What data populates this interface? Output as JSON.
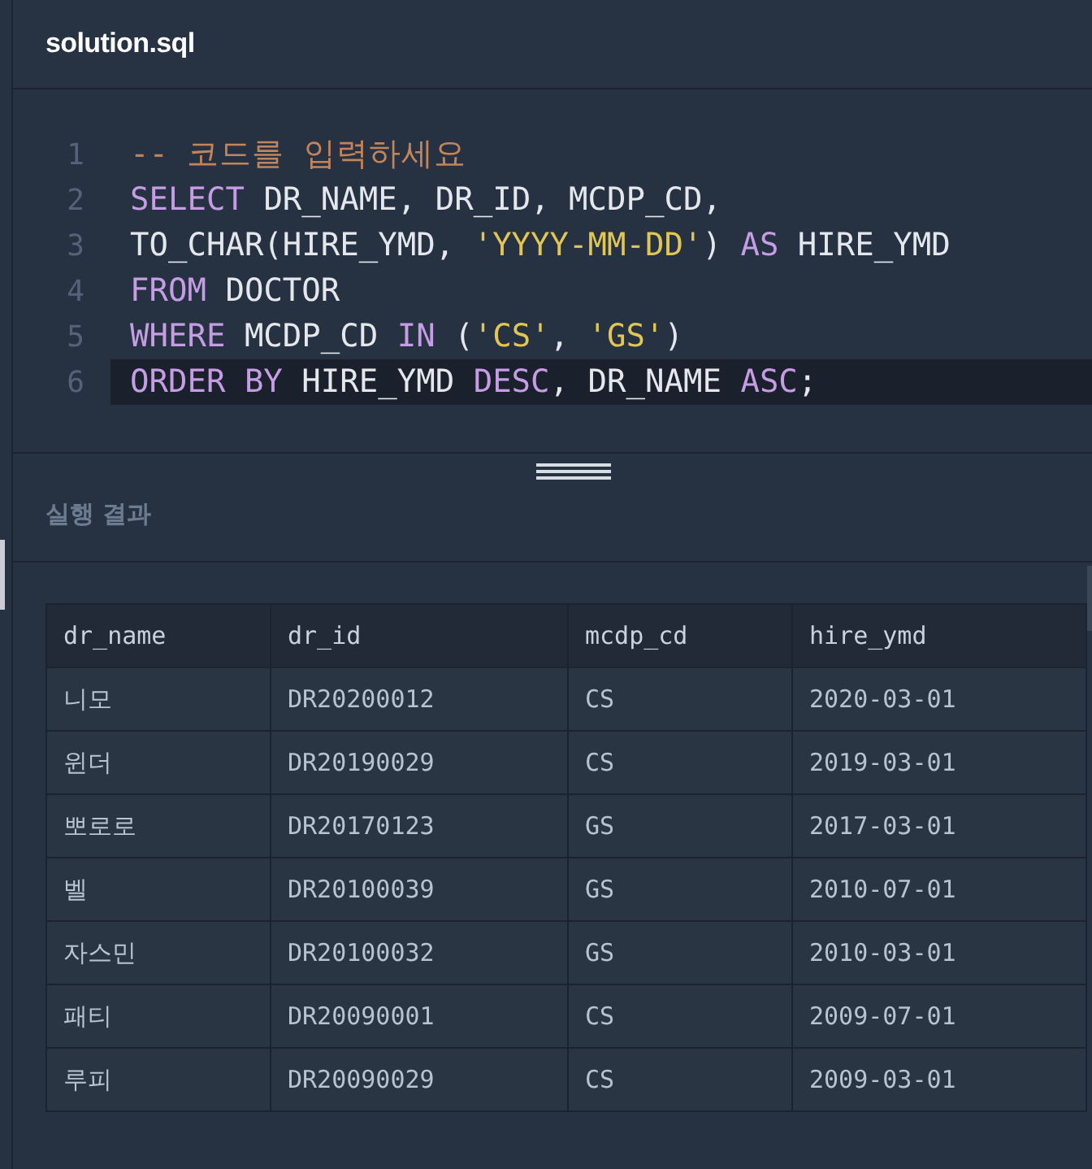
{
  "file_tab": {
    "title": "solution.sql"
  },
  "editor": {
    "lines": [
      {
        "number": "1",
        "active": false,
        "tokens": [
          {
            "kind": "comment",
            "text": "-- 코드를 입력하세요"
          }
        ]
      },
      {
        "number": "2",
        "active": false,
        "tokens": [
          {
            "kind": "keyword",
            "text": "SELECT"
          },
          {
            "kind": "plain",
            "text": " DR_NAME, DR_ID, MCDP_CD,"
          }
        ]
      },
      {
        "number": "3",
        "active": false,
        "tokens": [
          {
            "kind": "plain",
            "text": "TO_CHAR(HIRE_YMD, "
          },
          {
            "kind": "string",
            "text": "'YYYY-MM-DD'"
          },
          {
            "kind": "plain",
            "text": ") "
          },
          {
            "kind": "keyword",
            "text": "AS"
          },
          {
            "kind": "plain",
            "text": " HIRE_YMD"
          }
        ]
      },
      {
        "number": "4",
        "active": false,
        "tokens": [
          {
            "kind": "keyword",
            "text": "FROM"
          },
          {
            "kind": "plain",
            "text": " DOCTOR"
          }
        ]
      },
      {
        "number": "5",
        "active": false,
        "tokens": [
          {
            "kind": "keyword",
            "text": "WHERE"
          },
          {
            "kind": "plain",
            "text": " MCDP_CD "
          },
          {
            "kind": "keyword",
            "text": "IN"
          },
          {
            "kind": "plain",
            "text": " ("
          },
          {
            "kind": "string",
            "text": "'CS'"
          },
          {
            "kind": "plain",
            "text": ", "
          },
          {
            "kind": "string",
            "text": "'GS'"
          },
          {
            "kind": "plain",
            "text": ")"
          }
        ]
      },
      {
        "number": "6",
        "active": true,
        "tokens": [
          {
            "kind": "keyword",
            "text": "ORDER BY"
          },
          {
            "kind": "plain",
            "text": " HIRE_YMD "
          },
          {
            "kind": "keyword",
            "text": "DESC"
          },
          {
            "kind": "plain",
            "text": ", DR_NAME "
          },
          {
            "kind": "keyword",
            "text": "ASC"
          },
          {
            "kind": "plain",
            "text": ";"
          }
        ]
      }
    ]
  },
  "results": {
    "title": "실행 결과",
    "table": {
      "columns": [
        "dr_name",
        "dr_id",
        "mcdp_cd",
        "hire_ymd"
      ],
      "rows": [
        [
          "니모",
          "DR20200012",
          "CS",
          "2020-03-01"
        ],
        [
          "윈더",
          "DR20190029",
          "CS",
          "2019-03-01"
        ],
        [
          "뽀로로",
          "DR20170123",
          "GS",
          "2017-03-01"
        ],
        [
          "벨",
          "DR20100039",
          "GS",
          "2010-07-01"
        ],
        [
          "자스민",
          "DR20100032",
          "GS",
          "2010-03-01"
        ],
        [
          "패티",
          "DR20090001",
          "CS",
          "2009-07-01"
        ],
        [
          "루피",
          "DR20090029",
          "CS",
          "2009-03-01"
        ]
      ]
    }
  }
}
